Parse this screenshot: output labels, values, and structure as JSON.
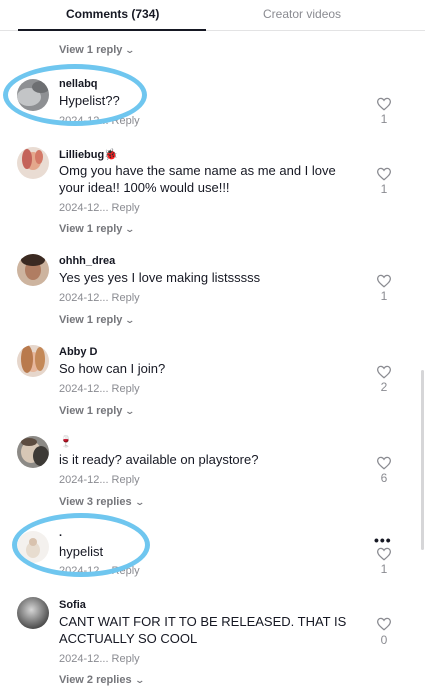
{
  "tabs": {
    "comments": "Comments (734)",
    "creator_videos": "Creator videos"
  },
  "top_partial": {
    "view_replies": "View 1 reply"
  },
  "comments": [
    {
      "username": "nellabq",
      "text": "Hypelist??",
      "date": "2024-12...",
      "reply": "Reply",
      "likes": "1",
      "view_replies": ""
    },
    {
      "username": "Lilliebug🐞",
      "text": "Omg you have the same name as me and I love your idea!! 100% would use!!!",
      "date": "2024-12...",
      "reply": "Reply",
      "likes": "1",
      "view_replies": "View 1 reply"
    },
    {
      "username": "ohhh_drea",
      "text": "Yes yes yes I love making listsssss",
      "date": "2024-12...",
      "reply": "Reply",
      "likes": "1",
      "view_replies": "View 1 reply"
    },
    {
      "username": "Abby D",
      "text": "So how can I join?",
      "date": "2024-12...",
      "reply": "Reply",
      "likes": "2",
      "view_replies": "View 1 reply"
    },
    {
      "username": "🍷",
      "text": "is it ready? available on playstore?",
      "date": "2024-12...",
      "reply": "Reply",
      "likes": "6",
      "view_replies": "View 3 replies"
    },
    {
      "username": ".",
      "text": "hypelist",
      "date": "2024-12...",
      "reply": "Reply",
      "likes": "1",
      "view_replies": ""
    },
    {
      "username": "Sofia",
      "text": "CANT WAIT FOR IT TO BE RELEASED. THAT IS ACCTUALLY SO COOL",
      "date": "2024-12...",
      "reply": "Reply",
      "likes": "0",
      "view_replies": "View 2 replies"
    }
  ],
  "colors": {
    "annotation_ring": "#6fc6ef",
    "text_primary": "#161823",
    "text_secondary": "#8a8b91"
  },
  "icons": {
    "like": "heart-outline-icon",
    "expand": "chevron-down-icon",
    "more": "more-horizontal-icon"
  }
}
